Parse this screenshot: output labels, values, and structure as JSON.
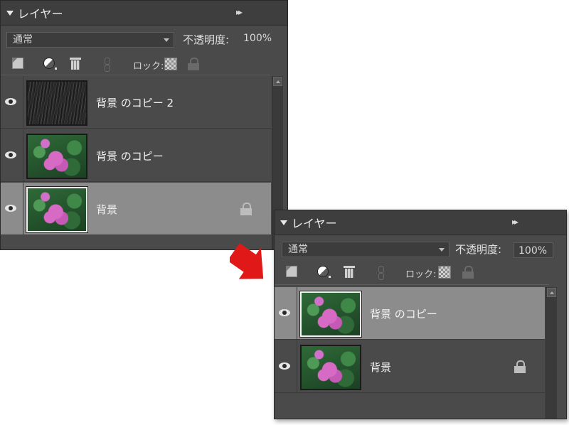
{
  "panel1": {
    "title": "レイヤー",
    "menu_glyph": "▸▸",
    "blend_mode": "通常",
    "opacity_label": "不透明度:",
    "opacity_value": "100%",
    "lock_label": "ロック:",
    "layers": [
      {
        "name": "背景 のコピー 2",
        "thumb": "rain",
        "visible": true,
        "selected": false,
        "locked": false
      },
      {
        "name": "背景 のコピー",
        "thumb": "flower",
        "visible": true,
        "selected": false,
        "locked": false
      },
      {
        "name": "背景",
        "thumb": "flower",
        "visible": true,
        "selected": true,
        "locked": true
      }
    ]
  },
  "panel2": {
    "title": "レイヤー",
    "menu_glyph": "▸▸",
    "blend_mode": "通常",
    "opacity_label": "不透明度:",
    "opacity_value": "100%",
    "lock_label": "ロック:",
    "layers": [
      {
        "name": "背景 のコピー",
        "thumb": "flower",
        "visible": true,
        "selected": true,
        "locked": false
      },
      {
        "name": "背景",
        "thumb": "flower",
        "visible": true,
        "selected": false,
        "locked": true
      }
    ]
  },
  "colors": {
    "panel_bg": "#4a4a4a",
    "selected_row": "#8c8c8c",
    "arrow": "#e01818"
  }
}
